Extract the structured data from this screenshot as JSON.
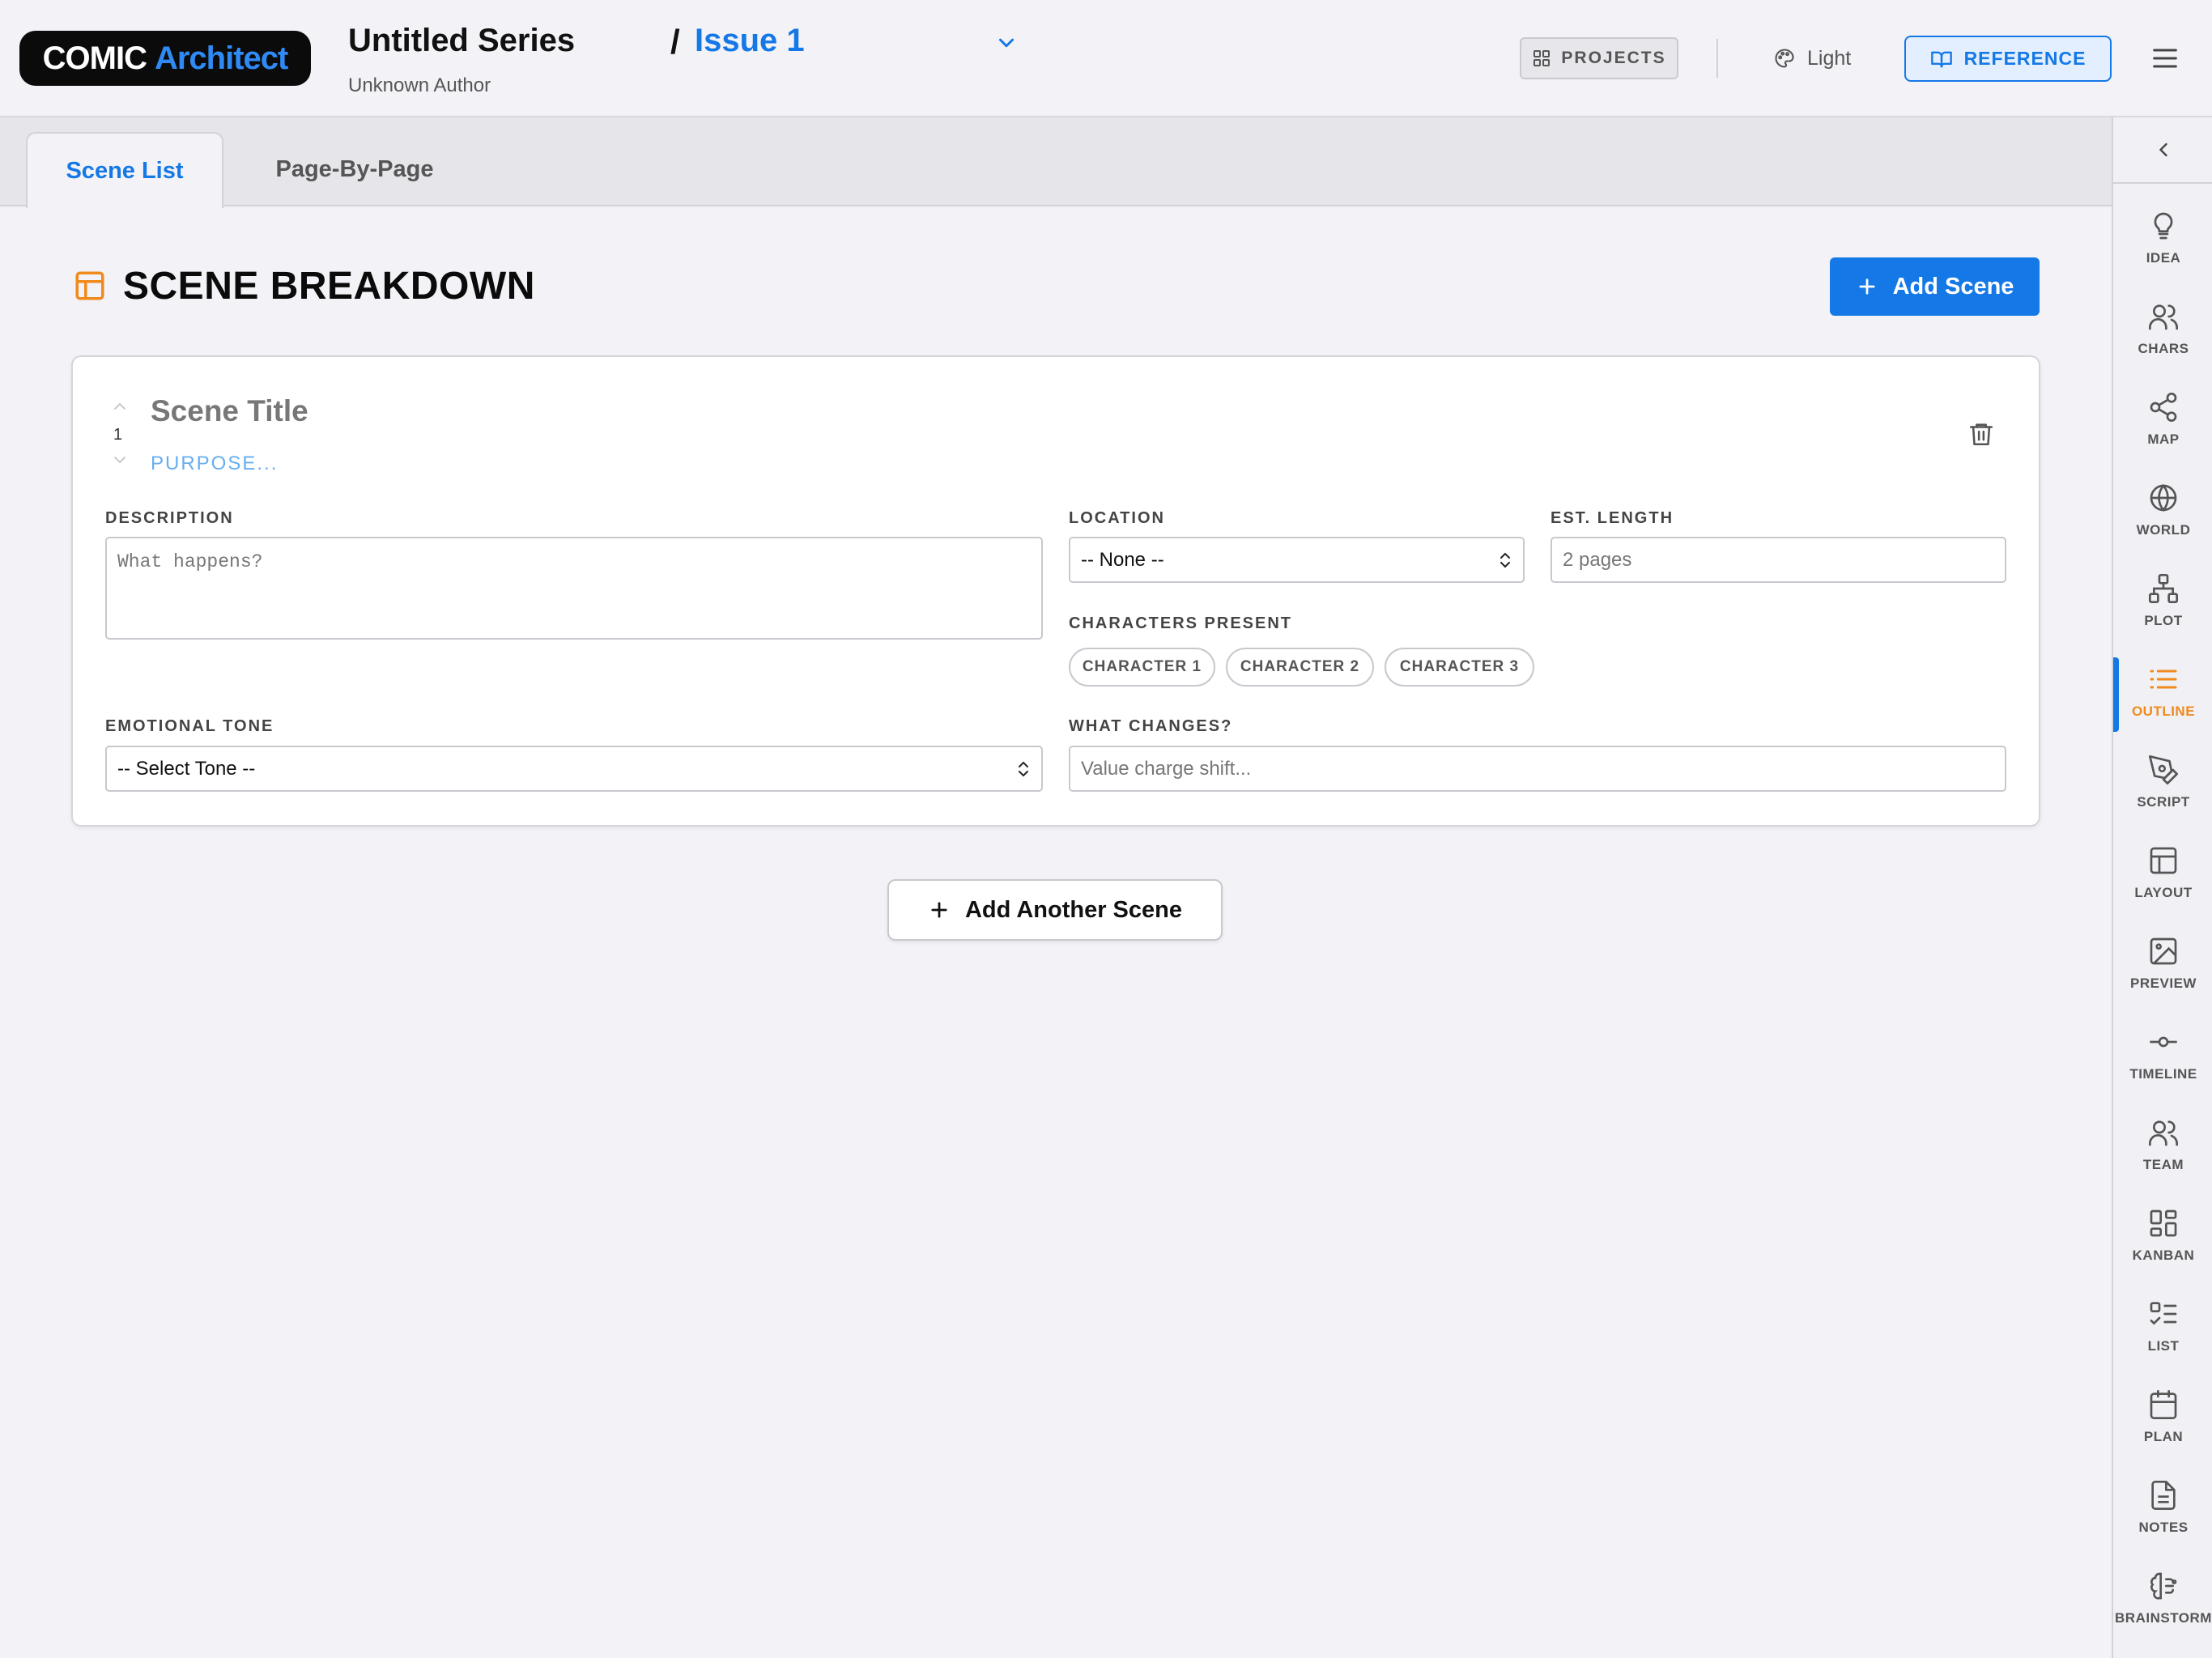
{
  "header": {
    "logo_part1": "COMIC",
    "logo_part2": "Architect",
    "series_title": "Untitled Series",
    "author": "Unknown Author",
    "issue_slash": "/",
    "issue_title": "Issue 1",
    "projects_label": "PROJECTS",
    "theme_label": "Light",
    "reference_label": "REFERENCE"
  },
  "tabs": [
    {
      "label": "Scene List",
      "active": true
    },
    {
      "label": "Page-By-Page",
      "active": false
    }
  ],
  "main": {
    "section_title": "SCENE BREAKDOWN",
    "add_scene_label": "Add Scene",
    "add_another_label": "Add Another Scene"
  },
  "scene": {
    "number": "1",
    "title_placeholder": "Scene Title",
    "purpose_placeholder": "PURPOSE...",
    "description_label": "DESCRIPTION",
    "description_placeholder": "What happens?",
    "location_label": "LOCATION",
    "location_value": "-- None --",
    "length_label": "EST. LENGTH",
    "length_placeholder": "2 pages",
    "characters_label": "CHARACTERS PRESENT",
    "characters": [
      "CHARACTER 1",
      "CHARACTER 2",
      "CHARACTER 3"
    ],
    "tone_label": "EMOTIONAL TONE",
    "tone_value": "-- Select Tone --",
    "changes_label": "WHAT CHANGES?",
    "changes_placeholder": "Value charge shift..."
  },
  "sidebar": {
    "items": [
      {
        "label": "IDEA",
        "icon": "lightbulb-icon"
      },
      {
        "label": "CHARS",
        "icon": "users-icon"
      },
      {
        "label": "MAP",
        "icon": "share-nodes-icon"
      },
      {
        "label": "WORLD",
        "icon": "globe-icon"
      },
      {
        "label": "PLOT",
        "icon": "hierarchy-icon"
      },
      {
        "label": "OUTLINE",
        "icon": "list-icon",
        "active": true
      },
      {
        "label": "SCRIPT",
        "icon": "pen-tool-icon"
      },
      {
        "label": "LAYOUT",
        "icon": "layout-icon"
      },
      {
        "label": "PREVIEW",
        "icon": "image-icon"
      },
      {
        "label": "TIMELINE",
        "icon": "timeline-icon"
      },
      {
        "label": "TEAM",
        "icon": "team-icon"
      },
      {
        "label": "KANBAN",
        "icon": "kanban-icon"
      },
      {
        "label": "LIST",
        "icon": "checklist-icon"
      },
      {
        "label": "PLAN",
        "icon": "calendar-icon"
      },
      {
        "label": "NOTES",
        "icon": "file-text-icon"
      },
      {
        "label": "BRAINSTORM",
        "icon": "brain-icon"
      }
    ]
  },
  "colors": {
    "accent": "#1478e6",
    "active_orange": "#f08a1c",
    "background": "#f2f2f7"
  }
}
